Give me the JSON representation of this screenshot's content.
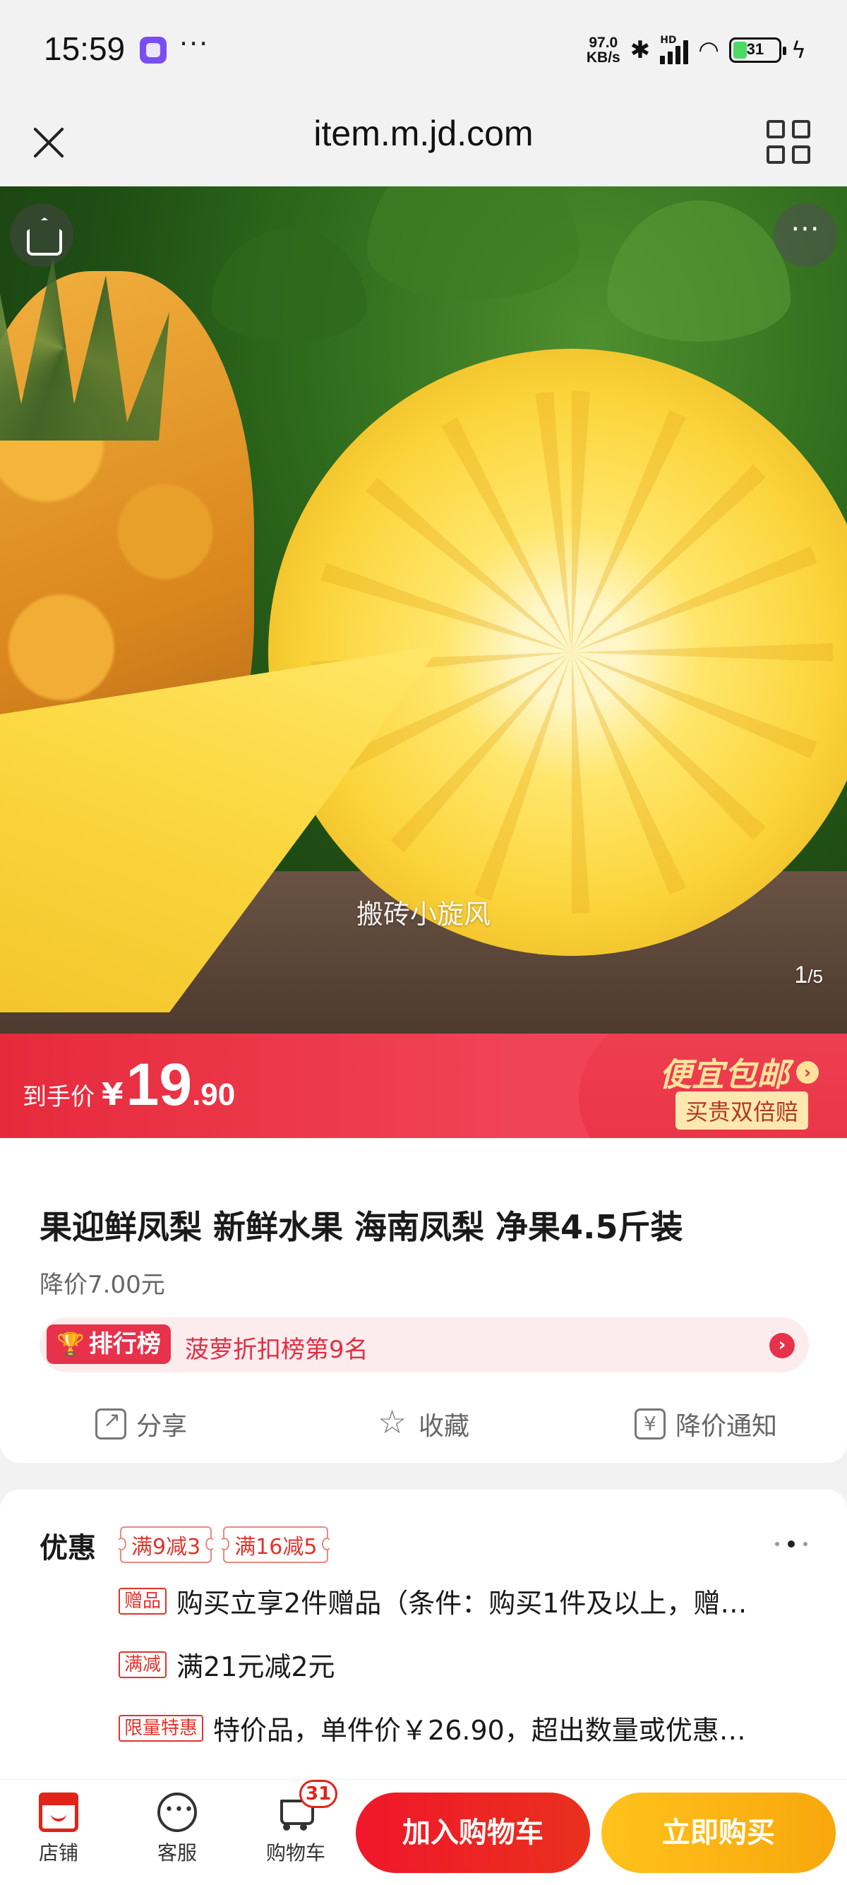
{
  "status_bar": {
    "time": "15:59",
    "net_speed_value": "97.0",
    "net_speed_unit": "KB/s",
    "signal_label": "HD",
    "battery_level": "31",
    "icons": [
      "app-notification-icon",
      "more-dots-icon",
      "bluetooth-icon",
      "signal-icon",
      "wifi-icon",
      "battery-icon",
      "charging-icon"
    ]
  },
  "browser": {
    "url": "item.m.jd.com",
    "close_icon": "close-icon",
    "menu_icon": "grid-menu-icon"
  },
  "gallery": {
    "watermark": "搬砖小旋风",
    "current": "1",
    "separator": "/",
    "total": "5",
    "more_label": "···"
  },
  "price_banner": {
    "label": "到手价",
    "currency": "¥",
    "price_int": "19",
    "price_dec": ".90",
    "promo_title": "便宜包邮",
    "promo_arrow": "›",
    "promo_sub": "买贵双倍赔"
  },
  "product": {
    "title": "果迎鲜凤梨 新鲜水果 海南凤梨 净果4.5斤装",
    "price_drop": "降价7.00元",
    "rank_badge": "排行榜",
    "rank_text": "菠萝折扣榜第9名",
    "rank_arrow": "›"
  },
  "actions": {
    "share": "分享",
    "favorite": "收藏",
    "price_alert": "降价通知"
  },
  "promotions": {
    "label": "优惠",
    "coupons": [
      "满9减3",
      "满16减5"
    ],
    "rows": [
      {
        "tag": "赠品",
        "text": "购买立享2件赠品（条件：购买1件及以上，赠…"
      },
      {
        "tag": "满减",
        "text": "满21元减2元"
      },
      {
        "tag": "限量特惠",
        "text": "特价品，单件价￥26.90，超出数量或优惠…"
      }
    ]
  },
  "bottom_bar": {
    "shop": "店铺",
    "service": "客服",
    "cart": "购物车",
    "cart_count": "31",
    "add_to_cart": "加入购物车",
    "buy_now": "立即购买"
  },
  "colors": {
    "jd_red": "#e2231a",
    "banner_red": "#e62a3c",
    "buy_yellow": "#ffc21c"
  }
}
